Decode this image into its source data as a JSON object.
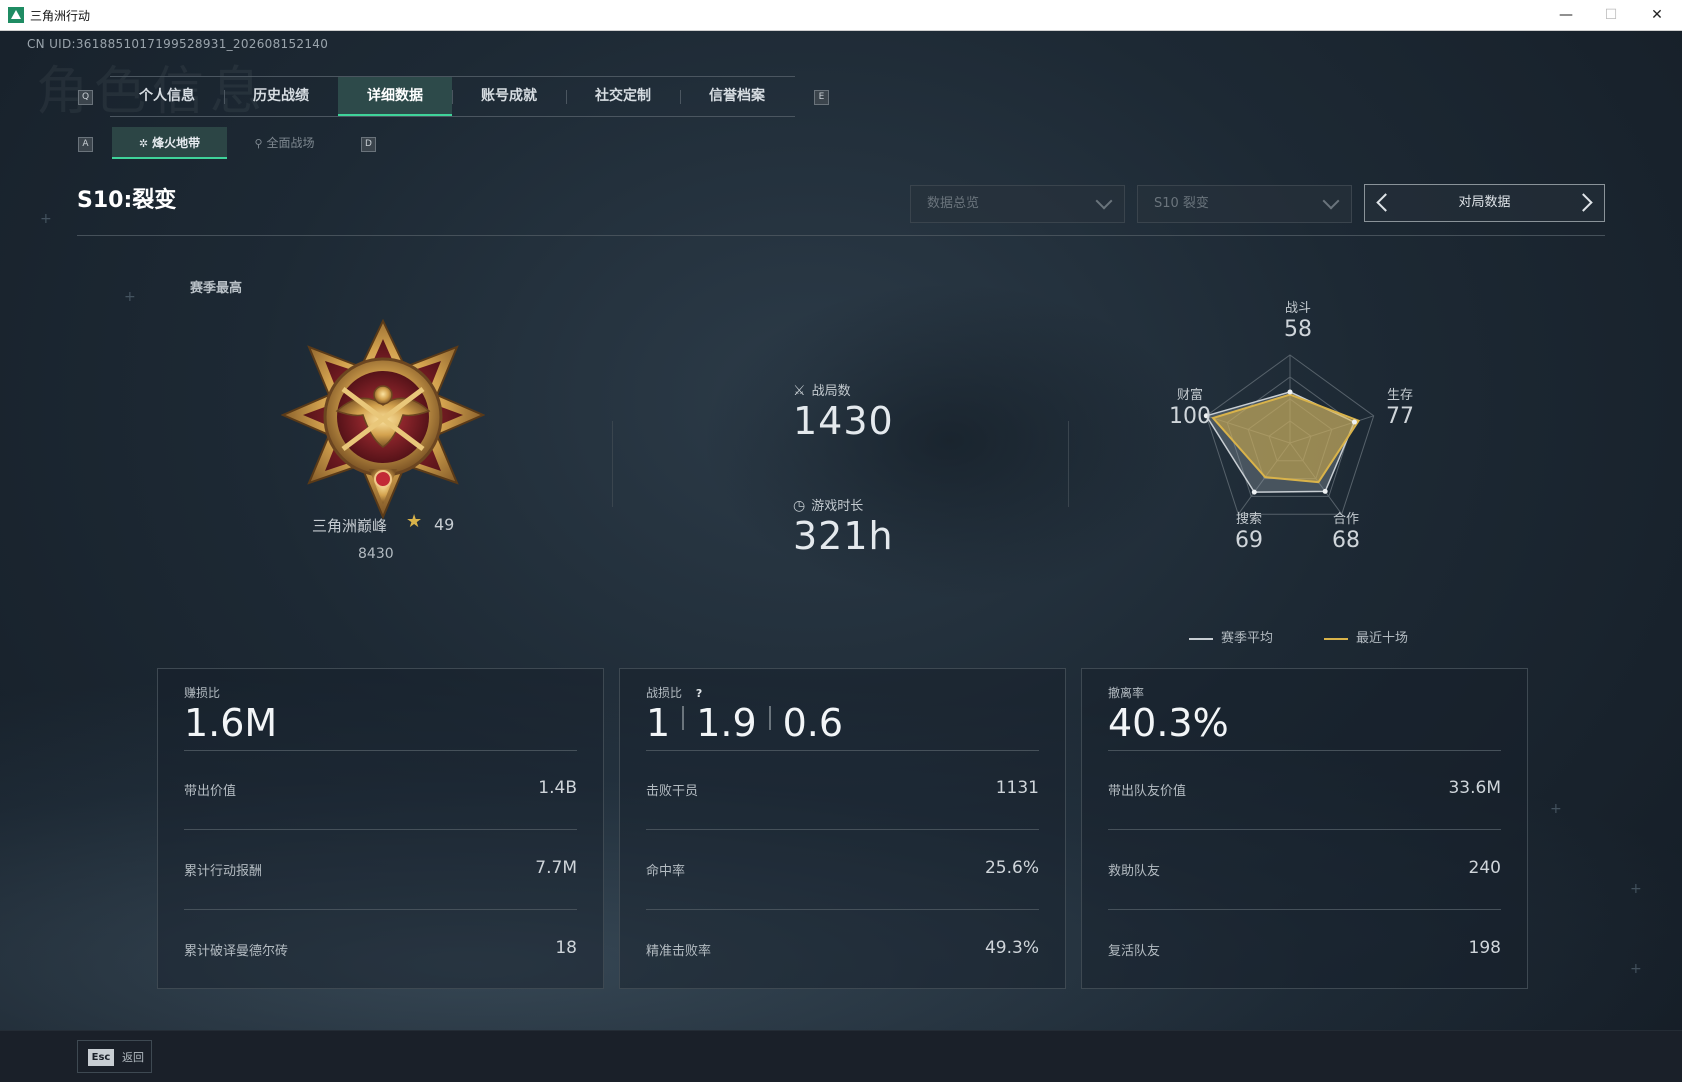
{
  "window": {
    "title": "三角洲行动",
    "minimize": "—",
    "maximize": "☐",
    "close": "✕"
  },
  "uid": "CN UID:361885101719952893​1_202608152140",
  "watermark": "角色信息",
  "keys": {
    "prev_tab": "Q",
    "next_tab": "E",
    "prev_sub": "A",
    "next_sub": "D"
  },
  "tabs": [
    {
      "label": "个人信息"
    },
    {
      "label": "历史战绩"
    },
    {
      "label": "详细数据",
      "active": true
    },
    {
      "label": "账号成就"
    },
    {
      "label": "社交定制"
    },
    {
      "label": "信誉档案"
    }
  ],
  "subtabs": [
    {
      "label": "烽火地带",
      "active": true
    },
    {
      "label": "全面战场"
    }
  ],
  "season_title": "S10:裂变",
  "filters": {
    "overview": "数据总览",
    "season": "S10 裂变",
    "pager_label": "对局数据"
  },
  "rank": {
    "section_label": "赛季最高",
    "name": "三角洲巅峰",
    "star": "★",
    "level": "49",
    "score": "8430"
  },
  "matches": {
    "label": "战局数",
    "value": "1430"
  },
  "playtime": {
    "label": "游戏时长",
    "value": "321h"
  },
  "radar": {
    "axes": [
      {
        "label": "战斗",
        "value": "58"
      },
      {
        "label": "生存",
        "value": "77"
      },
      {
        "label": "合作",
        "value": "68"
      },
      {
        "label": "搜索",
        "value": "69"
      },
      {
        "label": "财富",
        "value": "100"
      }
    ],
    "season_avg_fraction": [
      0.58,
      0.77,
      0.68,
      0.69,
      1.0
    ],
    "recent_ten_fraction": [
      0.55,
      0.82,
      0.55,
      0.48,
      0.92
    ],
    "legend": [
      {
        "label": "赛季平均",
        "color": "#c8ced3"
      },
      {
        "label": "最近十场",
        "color": "#d9b34a"
      }
    ]
  },
  "cards": [
    {
      "label": "赚损比",
      "big": "1.6M",
      "rows": [
        {
          "k": "带出价值",
          "v": "1.4B"
        },
        {
          "k": "累计行动报酬",
          "v": "7.7M"
        },
        {
          "k": "累计破译曼德尔砖",
          "v": "18"
        }
      ]
    },
    {
      "label": "战损比",
      "help": "?",
      "big_parts": [
        "1",
        "1.9",
        "0.6"
      ],
      "rows": [
        {
          "k": "击败干员",
          "v": "1131"
        },
        {
          "k": "命中率",
          "v": "25.6%"
        },
        {
          "k": "精准击败率",
          "v": "49.3%"
        }
      ]
    },
    {
      "label": "撤离率",
      "big": "40.3%",
      "rows": [
        {
          "k": "带出队友价值",
          "v": "33.6M"
        },
        {
          "k": "救助队友",
          "v": "240"
        },
        {
          "k": "复活队友",
          "v": "198"
        }
      ]
    }
  ],
  "footer": {
    "esc_key": "Esc",
    "esc_label": "返回"
  },
  "colors": {
    "accent": "#3fd39a",
    "gold": "#d9b34a",
    "bg": "#1d2934"
  }
}
